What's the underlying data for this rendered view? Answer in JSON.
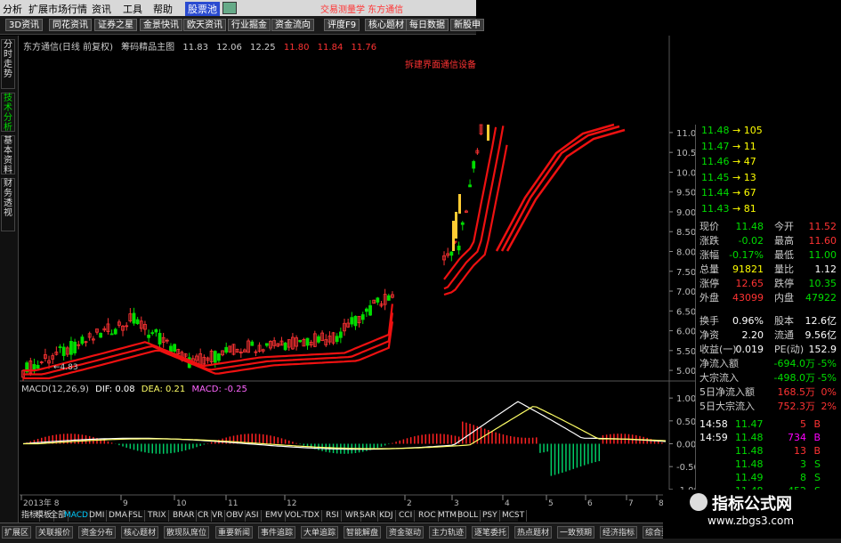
{
  "menubar": {
    "items": [
      "分析",
      "扩展市场行情",
      "资讯",
      "工具",
      "帮助"
    ],
    "active": "股票池",
    "promo": "交易测量学   东方通信"
  },
  "toolbar": {
    "buttons": [
      "3D资讯",
      "同花资讯",
      "证券之星",
      "金景快讯",
      "欧天资讯",
      "行业掘金",
      "资金流向",
      "评度F9",
      "核心题材",
      "每日数据",
      "新股申"
    ]
  },
  "sidetabs": [
    "分时走势",
    "技术分析",
    "基本资料",
    "财务透视"
  ],
  "chart_title": {
    "stock": "东方通信(日线 前复权)",
    "indicator": "筹码精品主图",
    "values": [
      "11.83",
      "12.06",
      "12.25",
      "11.80",
      "11.84",
      "11.76"
    ],
    "signal": "拆建界面通信设备",
    "low_label": "←4.83"
  },
  "macd": {
    "label": "MACD(12,26,9)",
    "dif": "DIF: 0.08",
    "dea": "DEA: 0.21",
    "macd": "MACD: -0.25"
  },
  "axis": {
    "price_ticks": [
      "11.00",
      "10.50",
      "10.00",
      "9.50",
      "9.00",
      "8.50",
      "8.00",
      "7.50",
      "7.00",
      "6.50",
      "6.00",
      "5.50",
      "5.00"
    ],
    "macd_ticks": [
      "1.00",
      "0.50",
      "0.00",
      "-0.50",
      "-1.00"
    ],
    "dates": [
      "2013年 8",
      "9",
      "10",
      "11",
      "12",
      "2",
      "3",
      "4",
      "5",
      "6",
      "7",
      "8"
    ]
  },
  "orderbook": [
    {
      "price": "11.48",
      "vol": "105"
    },
    {
      "price": "11.47",
      "vol": "11"
    },
    {
      "price": "11.46",
      "vol": "47"
    },
    {
      "price": "11.45",
      "vol": "13"
    },
    {
      "price": "11.44",
      "vol": "67"
    },
    {
      "price": "11.43",
      "vol": "81"
    }
  ],
  "quote": [
    {
      "l": "现价",
      "v": "11.48",
      "l2": "今开",
      "v2": "11.52",
      "c": "#00dd00",
      "c2": "#ff3333"
    },
    {
      "l": "涨跌",
      "v": "-0.02",
      "l2": "最高",
      "v2": "11.60",
      "c": "#00dd00",
      "c2": "#ff3333"
    },
    {
      "l": "涨幅",
      "v": "-0.17%",
      "l2": "最低",
      "v2": "11.00",
      "c": "#00dd00",
      "c2": "#00dd00"
    },
    {
      "l": "总量",
      "v": "91821",
      "l2": "量比",
      "v2": "1.12",
      "c": "#ffff00",
      "c2": "#ffffff"
    },
    {
      "l": "涨停",
      "v": "12.65",
      "l2": "跌停",
      "v2": "10.35",
      "c": "#ff3333",
      "c2": "#00dd00"
    },
    {
      "l": "外盘",
      "v": "43099",
      "l2": "内盘",
      "v2": "47922",
      "c": "#ff3333",
      "c2": "#00dd00"
    }
  ],
  "stats": [
    {
      "l": "换手",
      "v": "0.96%",
      "l2": "股本",
      "v2": "12.6亿"
    },
    {
      "l": "净资",
      "v": "2.20",
      "l2": "流通",
      "v2": "9.56亿"
    },
    {
      "l": "收益(一)",
      "v": "0.019",
      "l2": "PE(动)",
      "v2": "152.9"
    }
  ],
  "flows": [
    {
      "l": "净流入额",
      "v": "-694.0万",
      "p": "-5%",
      "c": "#00dd00"
    },
    {
      "l": "大宗流入",
      "v": "-498.0万",
      "p": "-5%",
      "c": "#00dd00"
    },
    {
      "l": "5日净流入额",
      "v": "168.5万",
      "p": "0%",
      "c": "#ff3333"
    },
    {
      "l": "5日大宗流入",
      "v": "752.3万",
      "p": "2%",
      "c": "#ff3333"
    }
  ],
  "ticks": [
    {
      "t": "14:58",
      "p": "11.47",
      "v": "5",
      "s": "B",
      "c": "#ff3333"
    },
    {
      "t": "14:59",
      "p": "11.48",
      "v": "734",
      "s": "B",
      "c": "#ff00ff"
    },
    {
      "t": "",
      "p": "11.48",
      "v": "13",
      "s": "B",
      "c": "#ff3333"
    },
    {
      "t": "",
      "p": "11.48",
      "v": "3",
      "s": "S",
      "c": "#00dd00"
    },
    {
      "t": "",
      "p": "11.49",
      "v": "8",
      "s": "S",
      "c": "#00dd00"
    },
    {
      "t": "",
      "p": "11.48",
      "v": "452",
      "s": "S",
      "c": "#00dd00"
    }
  ],
  "indicator_tabs": [
    "指标",
    "模板",
    "全部",
    "MACD",
    "DMI",
    "DMA",
    "FSL",
    "TRIX",
    "BRAR",
    "CR",
    "VR",
    "OBV",
    "ASI",
    "EMV",
    "VOL-TDX",
    "RSI",
    "WR",
    "SAR",
    "KDJ",
    "CCI",
    "ROC",
    "MTM",
    "BOLL",
    "PSY",
    "MCST"
  ],
  "bottom_tabs": [
    "扩展区",
    "关联报价",
    "资金分布",
    "核心题材",
    "散现队席位",
    "重要新闻",
    "事件追踪",
    "大单追踪",
    "智能解盘",
    "资金驱动",
    "主力轨迹",
    "逐笔委托",
    "热点题材",
    "一致预期",
    "经济指标",
    "综合资讯"
  ],
  "watermark": {
    "title": "指标公式网",
    "url": "www.zbgs3.com"
  },
  "colors": {
    "up": "#ff3333",
    "down": "#00dd00",
    "ma": "#ee1111"
  }
}
